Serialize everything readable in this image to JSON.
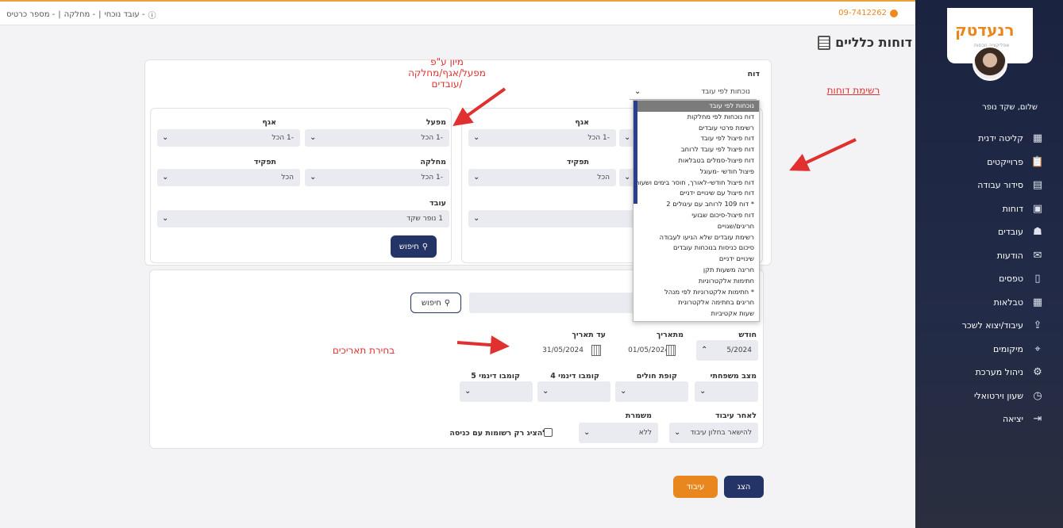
{
  "topbar": {
    "items_text": "(i) עובד נוכחי - | מחלקה - | מספר כרטיס -",
    "item_worker": "עובד נוכחי -",
    "item_department": "מחלקה -",
    "item_card": "מספר כרטיס -",
    "phone": "09-7412262"
  },
  "sidebar": {
    "logo": "רנעדטק",
    "logo_sub": "אפליקציה נוכחות",
    "greeting": "שלום, שקד נופר",
    "items": [
      {
        "label": "קליטה ידנית",
        "icon": "keypad-icon"
      },
      {
        "label": "פרוייקטים",
        "icon": "clipboard-icon"
      },
      {
        "label": "סידור עבודה",
        "icon": "calendar-icon"
      },
      {
        "label": "דוחות",
        "icon": "report-icon"
      },
      {
        "label": "עובדים",
        "icon": "workers-icon"
      },
      {
        "label": "הודעות",
        "icon": "messages-icon"
      },
      {
        "label": "טפסים",
        "icon": "forms-icon"
      },
      {
        "label": "טבלאות",
        "icon": "tables-icon"
      },
      {
        "label": "עיבוד/יצוא לשכר",
        "icon": "export-icon"
      },
      {
        "label": "מיקומים",
        "icon": "location-icon"
      },
      {
        "label": "ניהול מערכת",
        "icon": "admin-icon"
      },
      {
        "label": "שעון וירטואלי",
        "icon": "clock-icon"
      },
      {
        "label": "יציאה",
        "icon": "logout-icon"
      }
    ]
  },
  "page": {
    "title": "דוחות כלליים"
  },
  "report": {
    "label": "דוח",
    "selected": "נוכחות לפי עובד",
    "options": [
      "נוכחות לפי עובד",
      "דוח נוכחות לפי מחלקות",
      "רשימת פרטי עובדים",
      "דוח פיצול לפי עובד",
      "דוח פיצול לפי עובד לרוחב",
      "דוח פיצול-סמלים בטבלאות",
      "פיצול חודשי -מעוגל",
      "דוח פיצול חודשי-לאורך, חוסר בימים ושעות",
      "דוח פיצול עם שינויים ידניים",
      "* דוח 109 לרוחב עם עיגולים 2",
      "דוח פיצול-סיכום שבועי",
      "חריגים/שגויים",
      "רשימת עובדים שלא הגיעו לעבודה",
      "סיכום כניסות בנוכחות עובדים",
      "שינויים ידניים",
      "חריגה משעות תקן",
      "חתימות אלקטרוניות",
      "* חתימות אלקטרוניות לפי מנהל",
      "חריגים בחתימה אלקטרונית",
      "שעות אקטיביות"
    ]
  },
  "filters": {
    "agaf_label": "אגף",
    "agaf_value": "-1 הכל",
    "factory_label": "מפעל",
    "factory_value": "-1 הכל",
    "agaf2_label": "אגף",
    "agaf2_value": "-1 הכל",
    "role_label": "תפקיד",
    "role_value": "הכל",
    "department_label": "מחלקה",
    "department_value": "-1 הכל",
    "role2_label": "תפקיד",
    "role2_value": "הכל",
    "worker_label": "עובד",
    "worker_value": "1 נופר שקד",
    "search_label": "חיפוש"
  },
  "dates": {
    "search_label": "חיפוש",
    "month_label": "חודש",
    "month_value": "5/2024",
    "from_label": "מתאריך",
    "from_value": "01/05/2024",
    "to_label": "עד תאריך",
    "to_value": "31/05/2024",
    "marital_label": "מצב משפחתי",
    "kupat_label": "קופת חולים",
    "combo4_label": "קומבו דינמי 4",
    "combo5_label": "קומבו דינמי 5",
    "after_label": "לאחר עיבוד",
    "after_value": "להישאר בחלון עיבוד",
    "shift_label": "משמרת",
    "shift_value": "ללא",
    "entry_only_label": "להציג רק רשומות עם כניסה"
  },
  "footer": {
    "show_label": "הצג",
    "process_label": "עיבוד"
  },
  "annotations": {
    "sort_note": "מיון ע\"פ מפעל/אגף/מחלקה /עובדים",
    "reports_list_note": "רשימת דוחות",
    "dates_note": "בחירת תאריכים"
  },
  "colors": {
    "accent": "#e9871e",
    "primary": "#253466",
    "annotation": "#e03030"
  }
}
